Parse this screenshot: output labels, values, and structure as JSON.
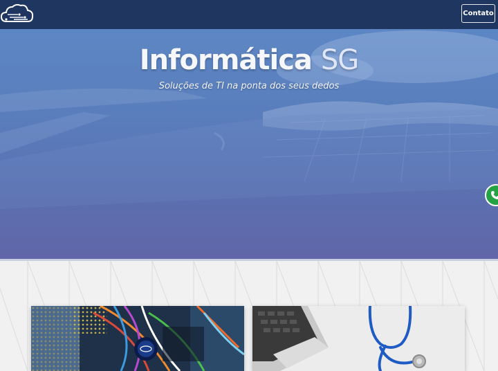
{
  "navbar": {
    "logo_icon": "cloud-circuit-logo-icon",
    "contact_label": "Contato"
  },
  "hero": {
    "title_main": "Informática",
    "title_accent": "SG",
    "subtitle": "Soluções de TI na ponta dos seus dedos",
    "background_icon": "laptop-keyboard-photo"
  },
  "floating": {
    "whatsapp_icon": "whatsapp-phone-icon"
  },
  "cards": [
    {
      "image": "computer-hardware-photo"
    },
    {
      "image": "laptop-stethoscope-photo"
    }
  ],
  "colors": {
    "navbar": "#1f3661",
    "hero_top": "#5d87c4",
    "hero_bottom": "#6066a8",
    "whatsapp": "#25a244"
  }
}
